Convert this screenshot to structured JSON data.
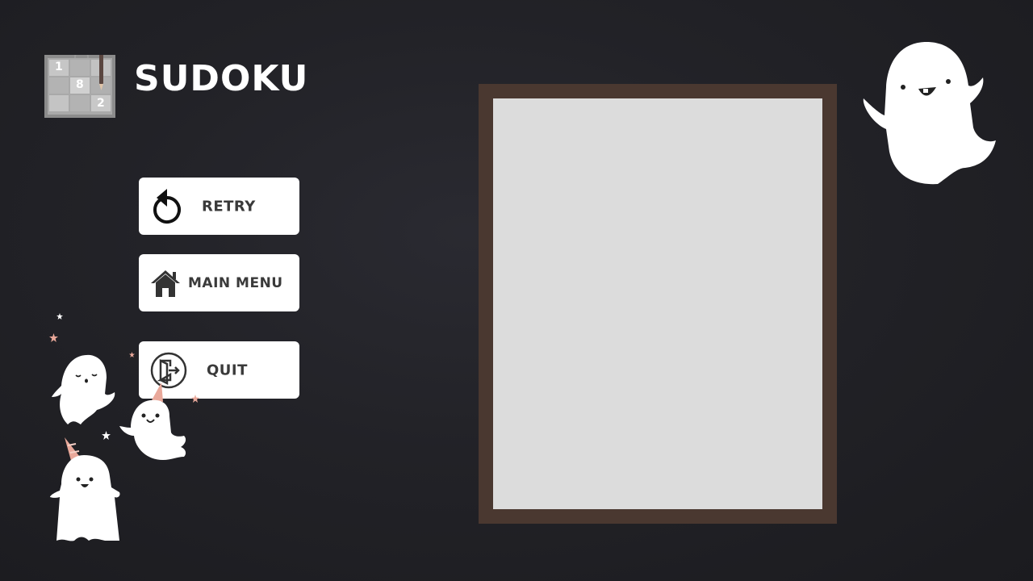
{
  "app": {
    "title": "SUDOKU",
    "logo_digits": [
      "1",
      "8",
      "2"
    ]
  },
  "menu": {
    "buttons": [
      {
        "id": "retry",
        "label": "RETRY",
        "icon": "retry-arrow-icon"
      },
      {
        "id": "main_menu",
        "label": "MAIN MENU",
        "icon": "house-icon"
      },
      {
        "id": "quit",
        "label": "QUIT",
        "icon": "exit-door-icon"
      }
    ]
  },
  "colors": {
    "background": "#222227",
    "board_frame": "#4a3830",
    "board_paper": "#dcdcdc",
    "button_bg": "#ffffff",
    "button_text": "#3a3a3a",
    "party_hat": "#e9a89a"
  }
}
